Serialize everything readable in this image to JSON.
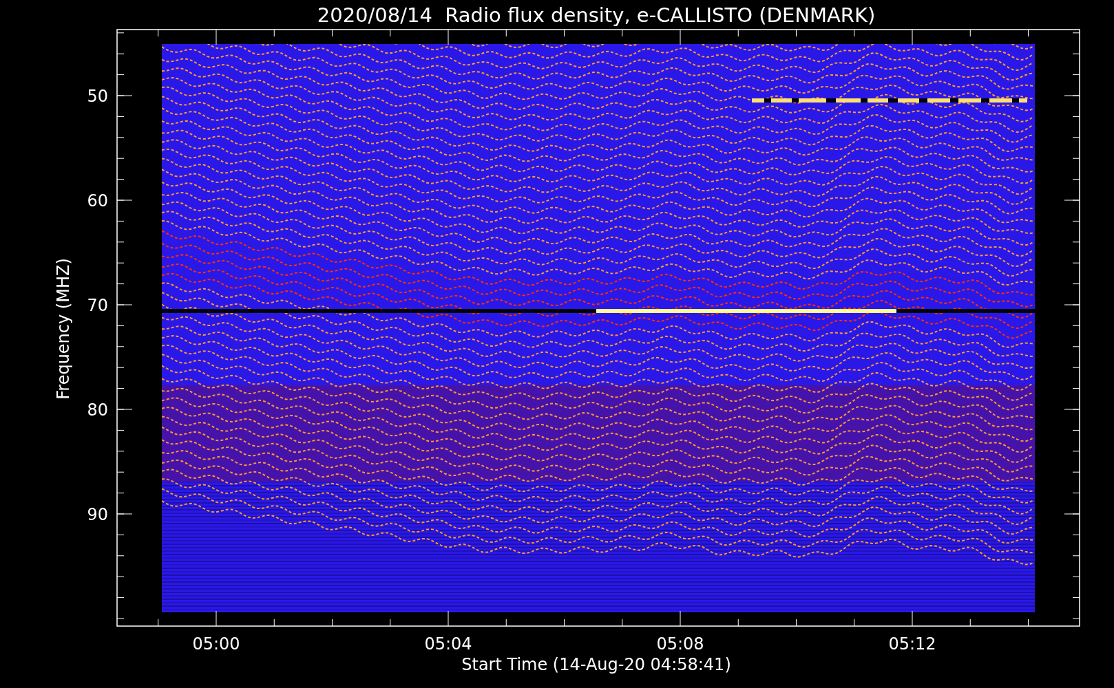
{
  "plot": {
    "title": "2020/08/14  Radio flux density, e-CALLISTO (DENMARK)",
    "ylabel": "Frequency (MHZ)",
    "xlabel": "Start Time (14-Aug-20 04:58:41)",
    "yticks": [
      "50",
      "60",
      "70",
      "80",
      "90"
    ],
    "xticks": [
      "05:00",
      "05:04",
      "05:08",
      "05:12"
    ]
  }
}
